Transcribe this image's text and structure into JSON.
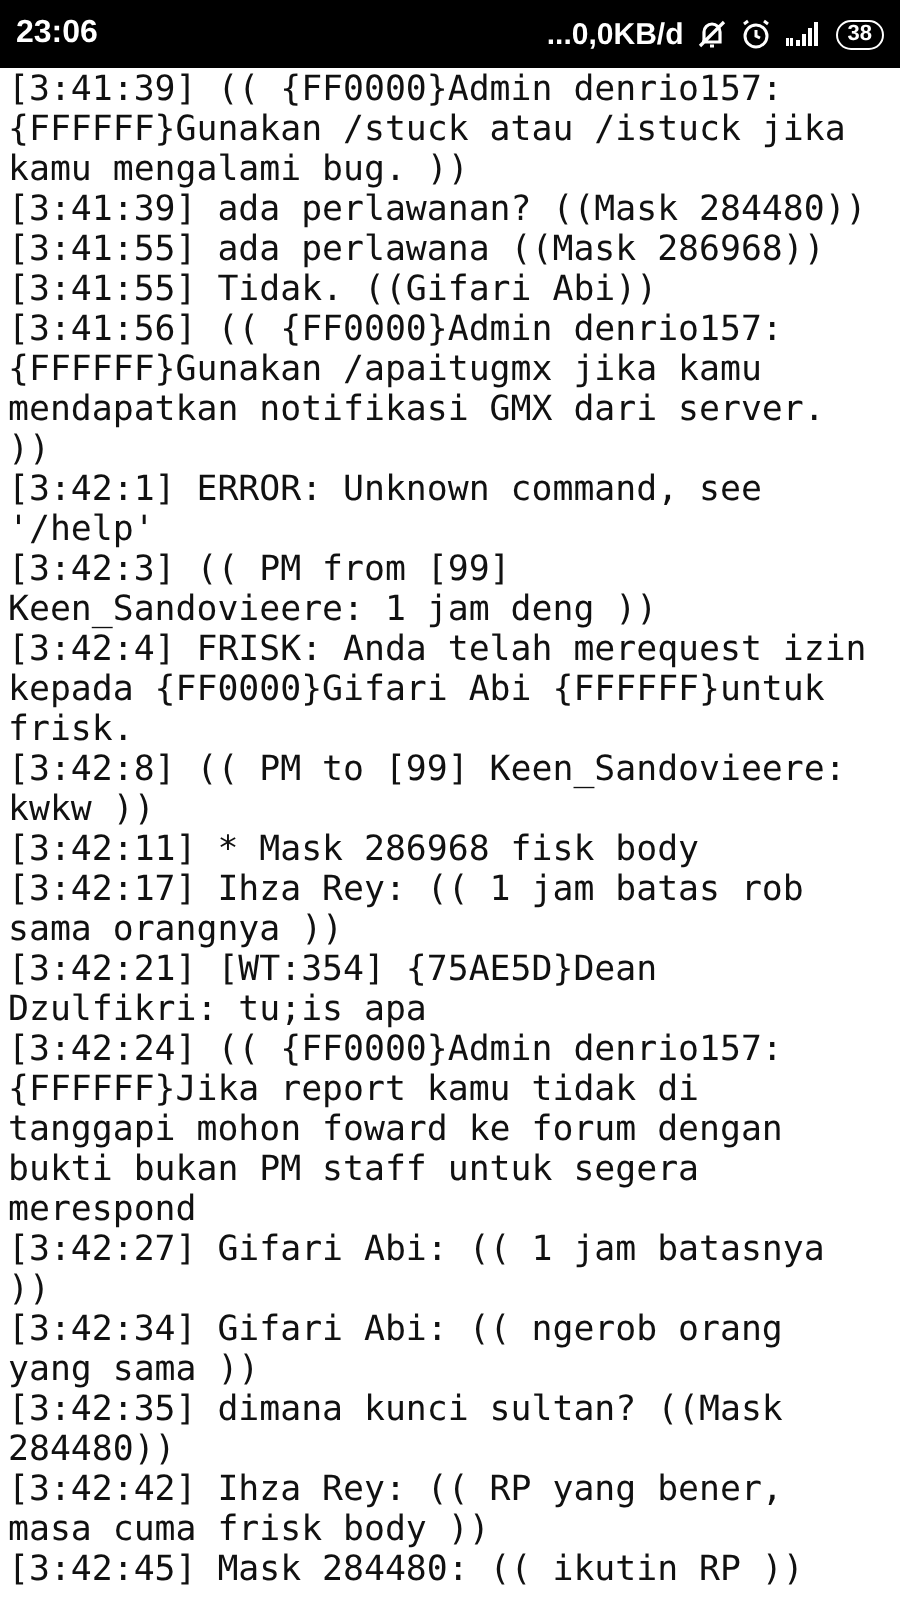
{
  "status_bar": {
    "time": "23:06",
    "network_speed": "...0,0KB/d",
    "battery": "38"
  },
  "messages": [
    "[3:41:39] (( {FF0000}Admin denrio157: {FFFFFF}Gunakan /stuck atau /istuck jika kamu mengalami bug. ))",
    "[3:41:39] ada perlawanan? ((Mask 284480))",
    "[3:41:55] ada perlawana ((Mask 286968))",
    "[3:41:55] Tidak. ((Gifari Abi))",
    "[3:41:56] (( {FF0000}Admin denrio157: {FFFFFF}Gunakan /apaitugmx jika kamu mendapatkan notifikasi GMX dari server. ))",
    "[3:42:1] ERROR: Unknown command, see '/help'",
    "[3:42:3] (( PM from [99] Keen_Sandovieere: 1 jam deng ))",
    "[3:42:4] FRISK: Anda telah merequest izin kepada {FF0000}Gifari Abi {FFFFFF}untuk frisk.",
    "[3:42:8] (( PM to [99] Keen_Sandovieere: kwkw ))",
    "[3:42:11] * Mask 286968 fisk body",
    "[3:42:17] Ihza Rey: (( 1 jam batas rob sama orangnya ))",
    "[3:42:21] [WT:354] {75AE5D}Dean Dzulfikri: tu;is apa",
    "[3:42:24] (( {FF0000}Admin denrio157: {FFFFFF}Jika report kamu tidak di tanggapi mohon foward ke forum dengan bukti bukan PM staff untuk segera merespond",
    "[3:42:27] Gifari Abi: (( 1 jam batasnya ))",
    "[3:42:34] Gifari Abi: (( ngerob orang yang sama ))",
    "[3:42:35] dimana kunci sultan? ((Mask 284480))",
    "[3:42:42] Ihza Rey: (( RP yang bener, masa cuma frisk body ))",
    "[3:42:45] Mask 284480: (( ikutin RP ))"
  ]
}
